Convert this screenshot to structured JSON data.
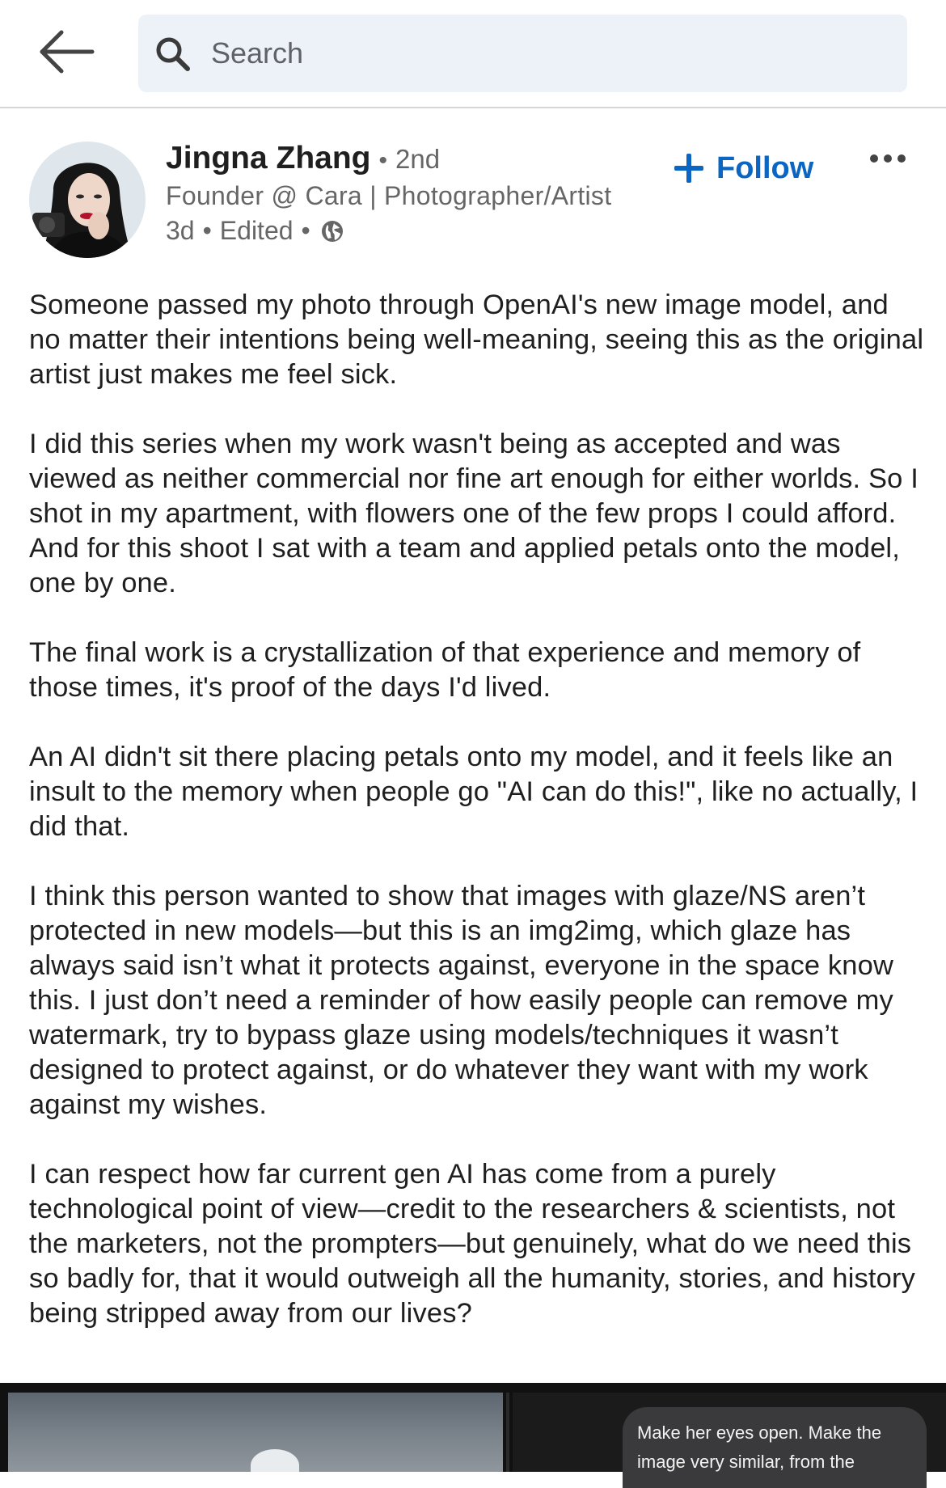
{
  "header": {
    "search_placeholder": "Search"
  },
  "post": {
    "author_name": "Jingna Zhang",
    "degree": "2nd",
    "headline": "Founder @ Cara | Photographer/Artist",
    "age": "3d",
    "edited_label": "Edited",
    "follow_label": "Follow",
    "paragraphs": [
      "Someone passed my photo through OpenAI's new image model, and no matter their intentions being well-meaning, seeing this as the original artist just makes me feel sick.",
      "I did this series when my work wasn't being as accepted and was viewed as neither commercial nor fine art enough for either worlds. So I shot in my apartment, with flowers one of the few props I could afford. And for this shoot I sat with a team and applied petals onto the model, one by one.",
      "The final work is a crystallization of that experience and memory of those times, it's proof of the days I'd lived.",
      "An AI didn't sit there placing petals onto my model, and it feels like an insult to the memory when people go \"AI can do this!\", like no actually, I did that.",
      "I think this person wanted to show that images with glaze/NS aren’t protected in new models—but this is an img2img, which glaze has always said isn’t what it protects against, everyone in the space know this. I just don’t need a reminder of how easily people can remove my watermark, try to bypass glaze using models/techniques it wasn’t designed to protect against, or do whatever they want with my work against my wishes.",
      "I can respect how far current gen AI has come from a purely technological point of view—credit to the researchers & scientists, not the marketers, not the prompters—but genuinely, what do we need this so badly for, that it would outweigh all the humanity, stories, and history being stripped away from our lives?"
    ],
    "media_prompt": "Make her eyes open. Make the image very similar, from the"
  },
  "colors": {
    "accent": "#0a66c2",
    "search_bg": "#edf2f8",
    "secondary_text": "#666666",
    "primary_text": "#1f1f1f"
  },
  "icons": {
    "back": "arrow-left-icon",
    "search": "search-icon",
    "visibility": "globe-icon",
    "follow": "plus-icon",
    "more": "ellipsis-icon"
  }
}
